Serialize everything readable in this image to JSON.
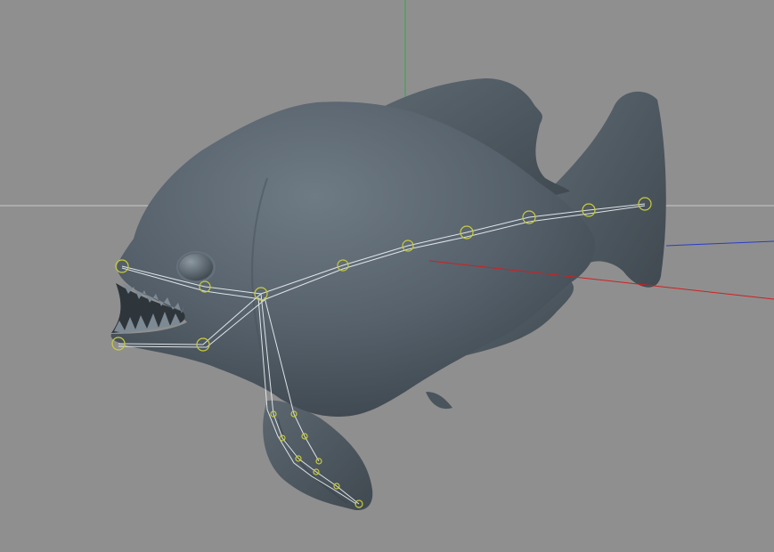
{
  "viewport": {
    "background_color": "#8f8f8f",
    "mesh_color": "#56616b",
    "bone_color": "#e6ecf0",
    "joint_color": "#c8cc3a",
    "axis_colors": {
      "x": "#d02020",
      "y": "#2fa84a",
      "z": "#2a3cc8",
      "horizon": "#d8d8d8"
    }
  }
}
